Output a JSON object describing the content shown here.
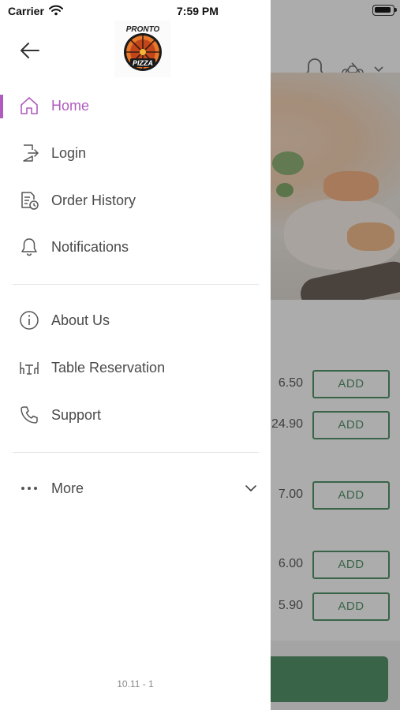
{
  "status_bar": {
    "carrier": "Carrier",
    "time": "7:59 PM"
  },
  "drawer": {
    "logo_alt": "Pronto Pizza",
    "logo_text_top": "PRONTO",
    "logo_text_bottom": "PIZZA",
    "menu": [
      {
        "label": "Home",
        "icon": "home-icon",
        "active": true
      },
      {
        "label": "Login",
        "icon": "login-icon"
      },
      {
        "label": "Order History",
        "icon": "order-history-icon"
      },
      {
        "label": "Notifications",
        "icon": "bell-icon"
      },
      {
        "label": "About Us",
        "icon": "info-icon"
      },
      {
        "label": "Table Reservation",
        "icon": "table-icon"
      },
      {
        "label": "Support",
        "icon": "phone-icon"
      },
      {
        "label": "More",
        "icon": "more-dots-icon"
      }
    ],
    "version": "10.11 - 1"
  },
  "background": {
    "items": [
      {
        "price": "6.50",
        "add_label": "ADD"
      },
      {
        "price": "24.90",
        "add_label": "ADD"
      },
      {
        "price": "7.00",
        "add_label": "ADD"
      },
      {
        "price": "6.00",
        "add_label": "ADD"
      },
      {
        "price": "5.90",
        "add_label": "ADD"
      }
    ]
  },
  "colors": {
    "accent": "#b05bbf",
    "green": "#2e7d4a"
  }
}
